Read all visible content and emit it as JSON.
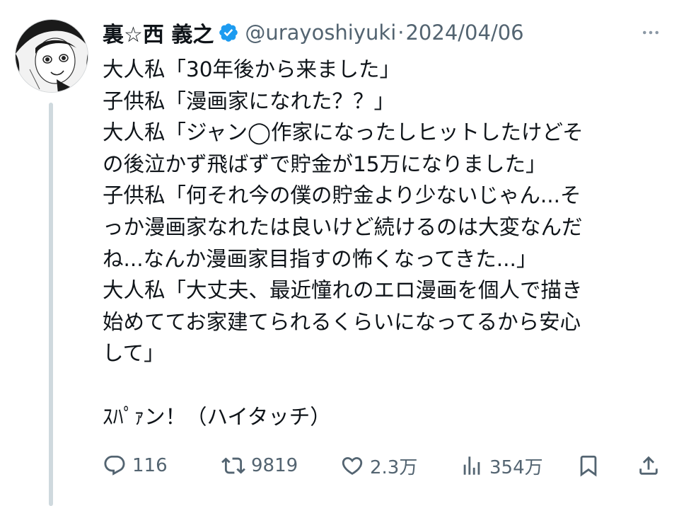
{
  "author": {
    "display_name": "裏☆西 義之",
    "handle": "@urayoshiyuki",
    "separator": "·",
    "timestamp": "2024/04/06"
  },
  "tweet": {
    "lines": [
      "大人私「30年後から来ました」",
      "子供私「漫画家になれた？？」",
      "大人私「ジャン◯作家になったしヒットしたけどそ",
      "の後泣かず飛ばずで貯金が15万になりました」",
      "子供私「何それ今の僕の貯金より少ないじゃん...そ",
      "っか漫画家なれたは良いけど続けるのは大変なんだ",
      "ね...なんか漫画家目指すの怖くなってきた...」",
      "大人私「大丈夫、最近憧れのエロ漫画を個人で描き",
      "始めててお家建てられるくらいになってるから安心",
      "して」",
      "",
      "ｽﾊﾟｧン！（ハイタッチ）"
    ]
  },
  "actions": {
    "replies": "116",
    "retweets": "9819",
    "likes": "2.3万",
    "views": "354万"
  },
  "icons": {
    "more": "more-dots-icon",
    "verified": "verified-badge-icon",
    "reply": "reply-icon",
    "retweet": "retweet-icon",
    "like": "heart-icon",
    "views": "views-chart-icon",
    "bookmark": "bookmark-icon",
    "share": "share-icon"
  },
  "colors": {
    "verified": "#1d9bf0",
    "text_primary": "#0f1419",
    "text_secondary": "#536471",
    "thread_line": "#cfd9de"
  }
}
